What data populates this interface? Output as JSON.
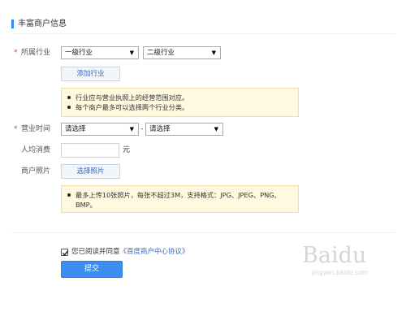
{
  "section": {
    "title": "丰富商户信息"
  },
  "industry": {
    "required_mark": "*",
    "label": "所属行业",
    "level1": "一级行业",
    "level2": "二级行业",
    "add_button": "添加行业",
    "notes": [
      "行业应与营业执照上的经营范围对应。",
      "每个商户最多可以选择两个行业分类。"
    ]
  },
  "hours": {
    "required_mark": "*",
    "label": "营业时间",
    "start": "请选择",
    "separator": "-",
    "end": "请选择"
  },
  "avg_spend": {
    "label": "人均消费",
    "value": "",
    "unit": "元"
  },
  "photos": {
    "label": "商户照片",
    "button": "选择照片",
    "notes": [
      "最多上传10张照片，每张不超过3M，支持格式：JPG、JPEG、PNG、BMP。"
    ]
  },
  "agreement": {
    "checked": true,
    "text": "您已阅读并同意",
    "link": "《百度商户中心协议》"
  },
  "submit": {
    "label": "提交"
  },
  "watermark": {
    "brand": "Baidu",
    "site": "jingyan.baidu.com"
  },
  "colors": {
    "accent": "#3385ff",
    "required": "#e4393c",
    "notice_bg": "#fff9e0",
    "submit": "#3c8ef0"
  }
}
